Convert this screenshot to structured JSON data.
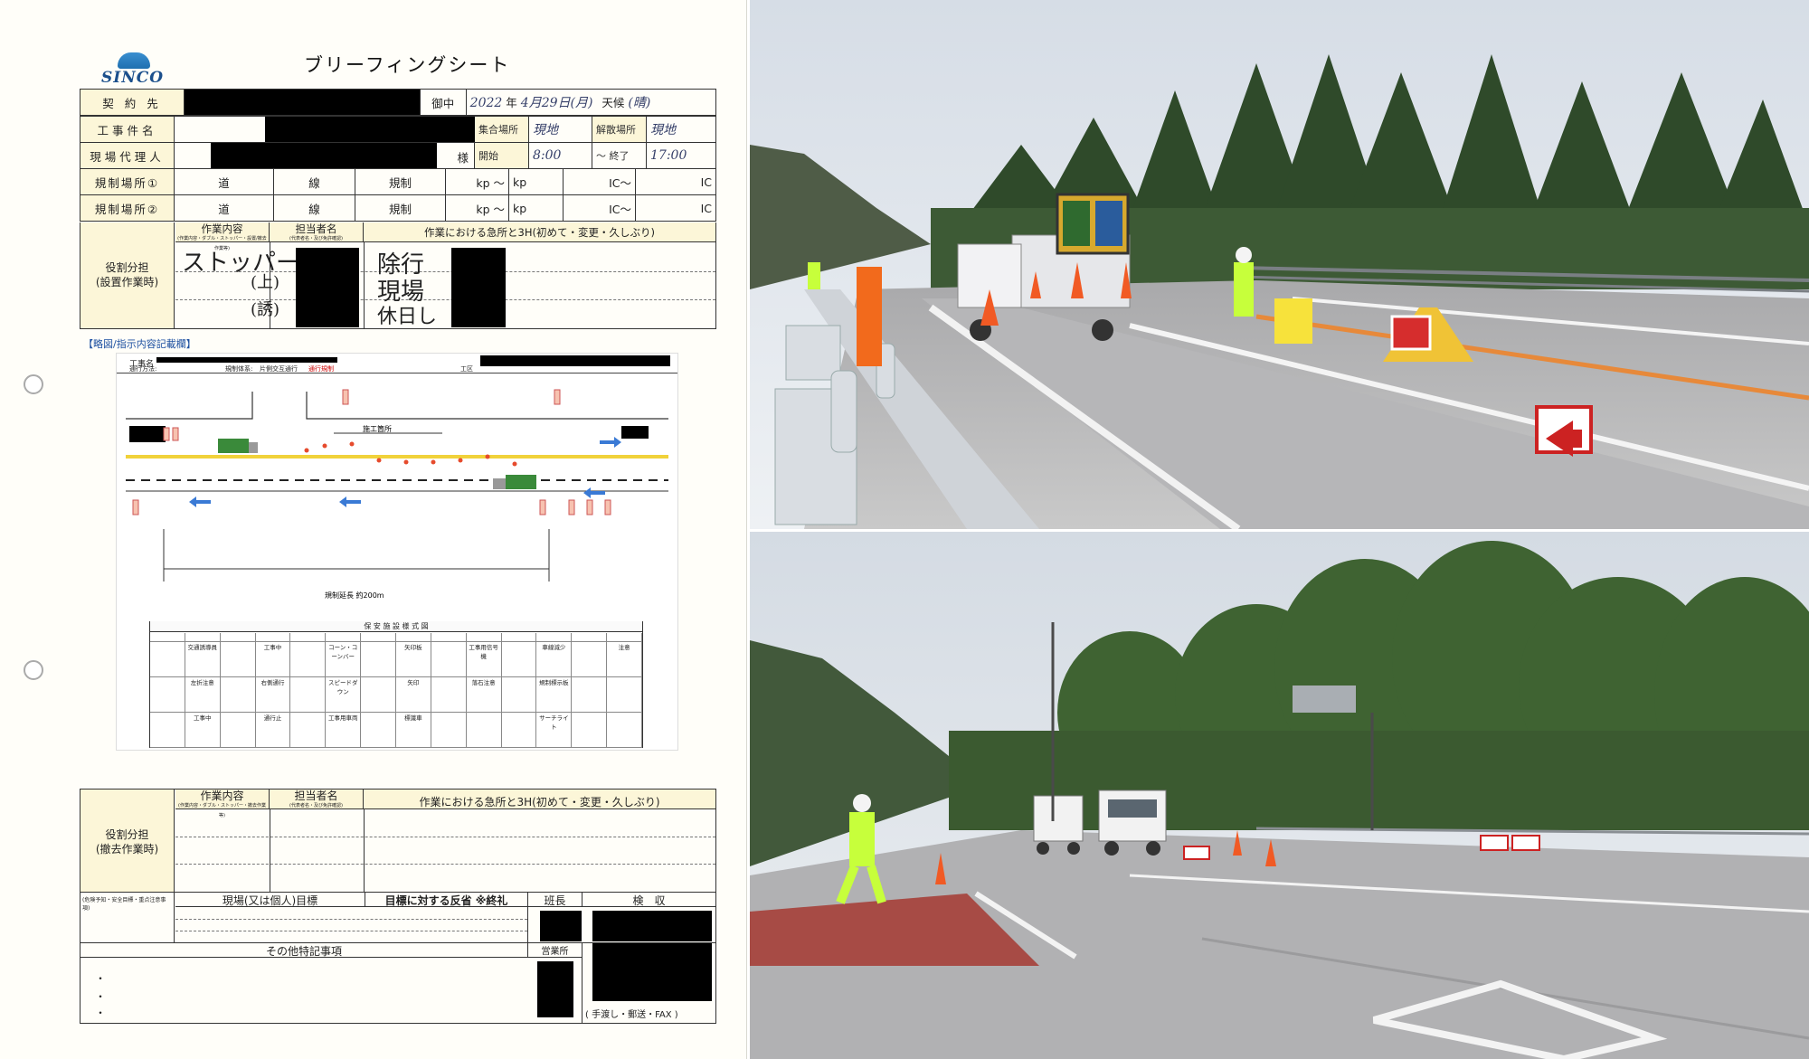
{
  "sheet": {
    "logo_text": "SINCO",
    "title": "ブリーフィングシート",
    "rows": {
      "contractor": "契 約 先",
      "honorific": "御中",
      "date_prefix": "2022",
      "date_year": "年",
      "date_month_day": "4月29日(月)",
      "weather_label": "天候",
      "weather_value": "(晴)",
      "project_name": "工事件名",
      "meeting_place": "集合場所",
      "meeting_value": "現地",
      "dismiss_place": "解散場所",
      "dismiss_value": "現地",
      "site_rep": "現場代理人",
      "sama": "様",
      "start_label": "開始",
      "start_value": "8:00",
      "end_label": "〜 終了",
      "end_value": "17:00",
      "reg1": "規制場所①",
      "reg2": "規制場所②",
      "road": "道",
      "line": "線",
      "regulation": "規制",
      "kp_from": "kp 〜",
      "kp_to": "kp",
      "ic_from": "IC〜",
      "ic_to": "IC"
    },
    "install": {
      "label_line1": "役割分担",
      "label_line2": "(設置作業時)",
      "work_content": "作業内容",
      "work_sub": "(作業内容・ダブル・ストッパー・設置/撤去作業等)",
      "person": "担当者名",
      "person_sub": "(代表者名・及び免許確認)",
      "hazard": "作業における急所と3H(初めて・変更・久しぶり)",
      "hand1": "ストッパー(下)",
      "hand2": "(上)",
      "hand3": "(誘)",
      "hand4": "除行",
      "hand5": "現場",
      "hand6": "休日し"
    },
    "diagram": {
      "caption": "【略図/指示内容記載欄】",
      "top_work": "工事名",
      "top_method": "通行方法:",
      "top_reg": "規制体系:",
      "top_one_side": "片側交互通行",
      "top_red": "通行規制",
      "top_section": "工区",
      "work_area": "施工箇所",
      "length": "規制延長 約200m",
      "legend_title": "保 安 施 設 様 式 図",
      "legend_items": [
        "交通誘導員",
        "工事中",
        "注意",
        "コーン・コーンバー",
        "矢印板",
        "工事用信号機",
        "矢印",
        "車線減少",
        "工事用車両",
        "左折注意",
        "右側通行",
        "スピードダウン",
        "標識車",
        "サーチライト",
        "工事中",
        "通行止",
        "落石注意",
        "規制標示板"
      ]
    },
    "remove": {
      "label_line1": "役割分担",
      "label_line2": "(撤去作業時)",
      "work_content": "作業内容",
      "work_sub": "(作業内容・ダブル・ストッパー・撤去作業等)",
      "person": "担当者名",
      "person_sub": "(代表者名・及び免許確認)",
      "hazard": "作業における急所と3H(初めて・変更・久しぶり)"
    },
    "goal": {
      "left_small": "(危険予知・安全目標・重点注意事項)",
      "goal": "現場(又は個人)目標",
      "reflect": "目標に対する反省 ※終礼",
      "leader": "班長",
      "inspection": "検　収"
    },
    "other": {
      "title": "その他特記事項",
      "bullet": "・",
      "office": "営業所",
      "delivery": "( 手渡し・郵送・FAX )"
    }
  }
}
